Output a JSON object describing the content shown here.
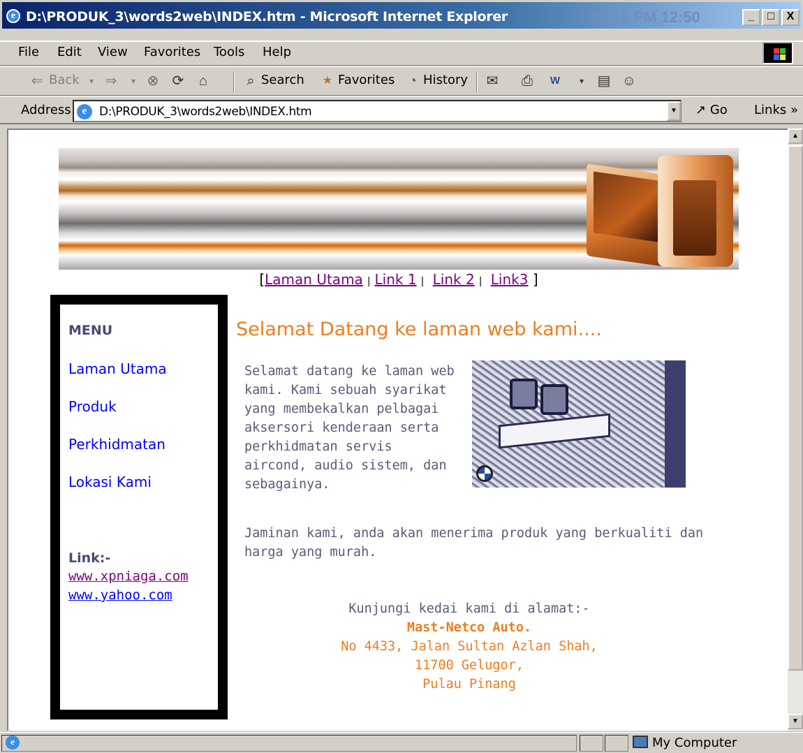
{
  "window": {
    "title": "D:\\PRODUK_3\\words2web\\INDEX.htm - Microsoft Internet Explorer",
    "clock": "12:18 PM 12:50",
    "buttons": [
      "_",
      "□",
      "X"
    ]
  },
  "menubar": {
    "items": [
      "File",
      "Edit",
      "View",
      "Favorites",
      "Tools",
      "Help"
    ]
  },
  "toolbar": {
    "back_label": "Back",
    "search_label": "Search",
    "favorites_label": "Favorites",
    "history_label": "History"
  },
  "addressbar": {
    "label": "Address",
    "url": "D:\\PRODUK_3\\words2web\\INDEX.htm",
    "go_label": "Go",
    "links_label": "Links »"
  },
  "page": {
    "topnav": {
      "open": "[",
      "close": "]",
      "links": [
        "Laman Utama",
        "Link 1",
        "Link 2",
        "Link3"
      ]
    },
    "sidebar": {
      "menu_title": "MENU",
      "menu_items": [
        "Laman Utama",
        "Produk",
        "Perkhidmatan",
        "Lokasi Kami"
      ],
      "links_title": "Link:-",
      "external_links": [
        "www.xpniaga.com",
        "www.yahoo.com"
      ]
    },
    "heading": "Selamat Datang ke laman web kami....",
    "intro": "Selamat datang ke laman web kami. Kami sebuah syarikat yang membekalkan pelbagai aksersori kenderaan serta perkhidmatan servis aircond, audio sistem, dan sebagainya.",
    "guarantee": "Jaminan kami, anda akan menerima produk yang berkualiti dan harga yang murah.",
    "visit": {
      "lead": "Kunjungi kedai kami di alamat:-",
      "company": "Mast-Netco Auto.",
      "address_lines": [
        "No 4433, Jalan Sultan Azlan Shah,",
        "11700 Gelugor,",
        "Pulau Pinang"
      ]
    }
  },
  "statusbar": {
    "zone": "My Computer"
  },
  "colors": {
    "accent_orange": "#f07d1e",
    "body_text": "#5a5a7a",
    "link": "#0000ff",
    "visited": "#800080"
  }
}
